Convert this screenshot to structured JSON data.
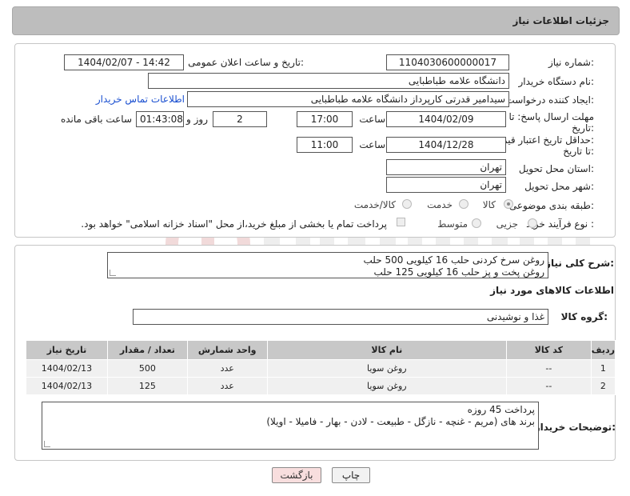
{
  "header": {
    "title": "جزئیات اطلاعات نیاز"
  },
  "form": {
    "need_number": {
      "label": "شماره نیاز:",
      "value": "1104030600000017"
    },
    "announce_datetime": {
      "label": "تاریخ و ساعت اعلان عمومی:",
      "value": "1404/02/07 - 14:42"
    },
    "buyer_org": {
      "label": "نام دستگاه خریدار:",
      "value": "دانشگاه علامه طباطبایی"
    },
    "requester": {
      "label": "ایجاد کننده درخواست:",
      "value": "سیدامیر قدرتی کارپرداز دانشگاه علامه طباطبایی",
      "contact_link": "اطلاعات تماس خریدار"
    },
    "reply_deadline": {
      "label_line1": "مهلت ارسال پاسخ: تا",
      "label_line2": "تاریخ:",
      "date": "1404/02/09",
      "time_label": "ساعت",
      "time": "17:00",
      "days": "2",
      "days_label": "روز و",
      "remaining": "01:43:08",
      "remaining_label": "ساعت باقی مانده"
    },
    "price_validity": {
      "label_line1": "حداقل تاریخ اعتبار قیمت:",
      "label_line2": "تا تاریخ:",
      "date": "1404/12/28",
      "time_label": "ساعت",
      "time": "11:00"
    },
    "delivery_province": {
      "label": "استان محل تحویل:",
      "value": "تهران"
    },
    "delivery_city": {
      "label": "شهر محل تحویل:",
      "value": "تهران"
    },
    "category": {
      "label": "طبقه بندی موضوعی:",
      "options": [
        "کالا",
        "خدمت",
        "کالا/خدمت"
      ]
    },
    "purchase_type": {
      "label": "نوع فرآیند خرید :",
      "options": [
        "جزیی",
        "متوسط"
      ],
      "note": "پرداخت تمام یا بخشی از مبلغ خرید،از محل \"اسناد خزانه اسلامی\" خواهد بود."
    }
  },
  "summary": {
    "label": "شرح کلی نیاز:",
    "line1": "روغن سرخ کردنی حلب 16 کیلویی 500 حلب",
    "line2": "روغن پخت و پز حلب 16 کیلویی 125 حلب"
  },
  "goods": {
    "section_title": "اطلاعات کالاهای مورد نیاز",
    "group_label": "گروه کالا:",
    "group_value": "غذا و نوشیدنی",
    "columns": [
      "ردیف",
      "کد کالا",
      "نام کالا",
      "واحد شمارش",
      "تعداد / مقدار",
      "تاریخ نیاز"
    ],
    "rows": [
      [
        "1",
        "--",
        "روغن سویا",
        "عدد",
        "500",
        "1404/02/13"
      ],
      [
        "2",
        "--",
        "روغن سویا",
        "عدد",
        "125",
        "1404/02/13"
      ]
    ]
  },
  "buyer_notes": {
    "label": "توضیحات خریدار:",
    "line1": "پرداخت 45 روزه",
    "line2": "برند های (مریم - غنچه - نازگل - طبیعت - لادن - بهار - فامیلا - اویلا)"
  },
  "buttons": {
    "print": "چاپ",
    "back": "بازگشت"
  },
  "colors": {
    "header_bg": "#bdbdbd",
    "link": "#1a4fd0",
    "back_button_bg": "#f8dede"
  }
}
